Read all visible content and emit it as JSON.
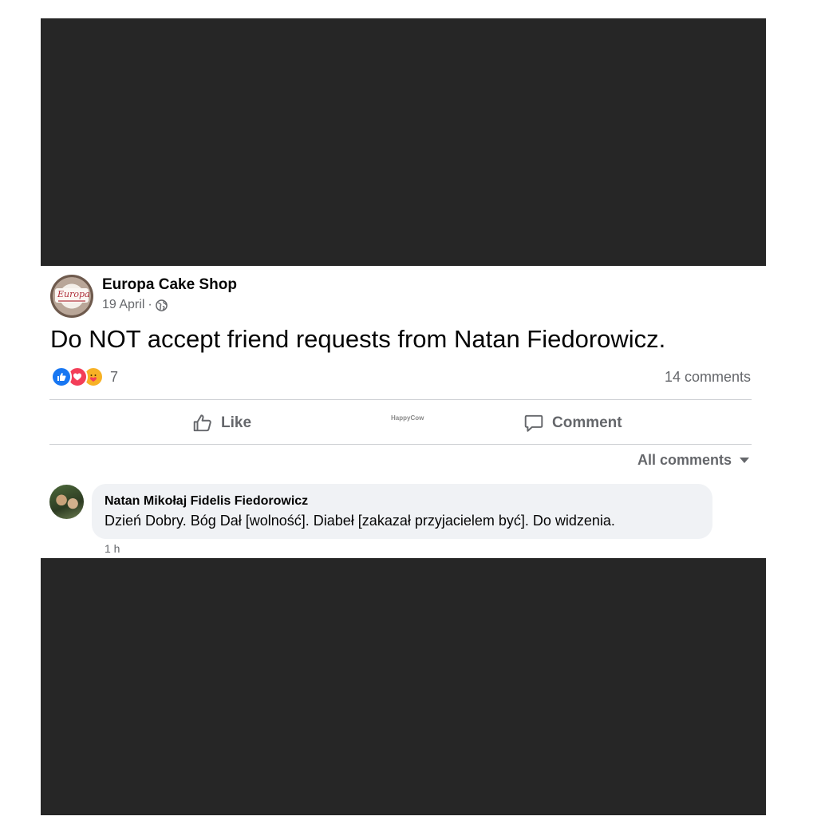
{
  "post": {
    "page_name": "Europa Cake Shop",
    "page_logo_text": "Europa",
    "date": "19 April",
    "separator": "·",
    "privacy_icon": "globe-icon",
    "text": "Do NOT accept friend requests from Natan Fiedorowicz.",
    "reactions": {
      "icons": [
        "like-icon",
        "love-icon",
        "care-icon"
      ],
      "count": "7"
    },
    "comments_count": "14 comments"
  },
  "actions": {
    "like_label": "Like",
    "comment_label": "Comment"
  },
  "watermark": "HappyCow",
  "comments_filter": {
    "label": "All comments"
  },
  "comment": {
    "author": "Natan Mikołaj Fidelis Fiedorowicz",
    "text": "Dzień Dobry. Bóg Dał [wolność]. Diabeł [zakazał przyjacielem być]. Do widzenia.",
    "time": "1 h"
  },
  "colors": {
    "redaction": "#262626",
    "secondary_text": "#65676b",
    "like_blue": "#1877f2",
    "love_red": "#f33e58",
    "care_yellow": "#f7b125",
    "bubble_bg": "#f0f2f5"
  }
}
